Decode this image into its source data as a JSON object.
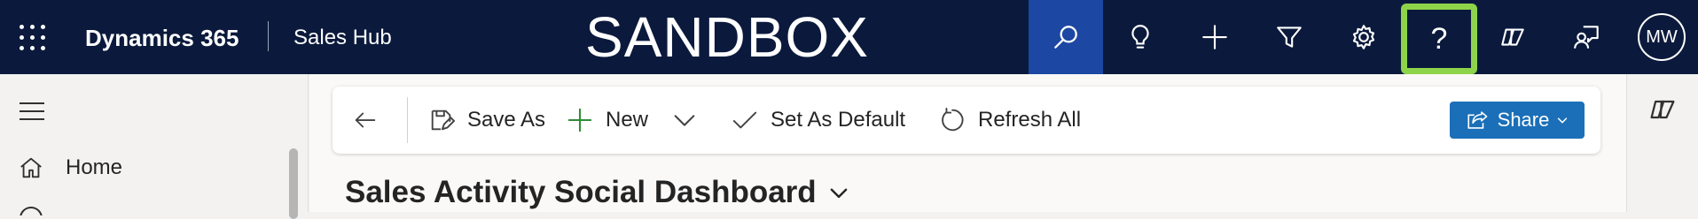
{
  "topbar": {
    "product": "Dynamics 365",
    "app": "Sales Hub",
    "environment": "SANDBOX",
    "bg_color": "#0b1a3c",
    "search_active_color": "#1c47a2",
    "highlight_color": "#8dd44a",
    "icons": [
      "app-launcher-icon",
      "search-icon",
      "lightbulb-icon",
      "plus-icon",
      "filter-icon",
      "gear-icon",
      "help-icon",
      "copilot-icon",
      "remote-assist-icon"
    ],
    "help_glyph": "?",
    "avatar_initials": "MW"
  },
  "nav": {
    "items": [
      {
        "label": "Home",
        "icon": "home-icon"
      }
    ]
  },
  "toolbar": {
    "save_as": "Save As",
    "new": "New",
    "set_default": "Set As Default",
    "refresh_all": "Refresh All",
    "share": "Share",
    "share_color": "#1a6fb8"
  },
  "dashboard": {
    "title": "Sales Activity Social Dashboard"
  }
}
